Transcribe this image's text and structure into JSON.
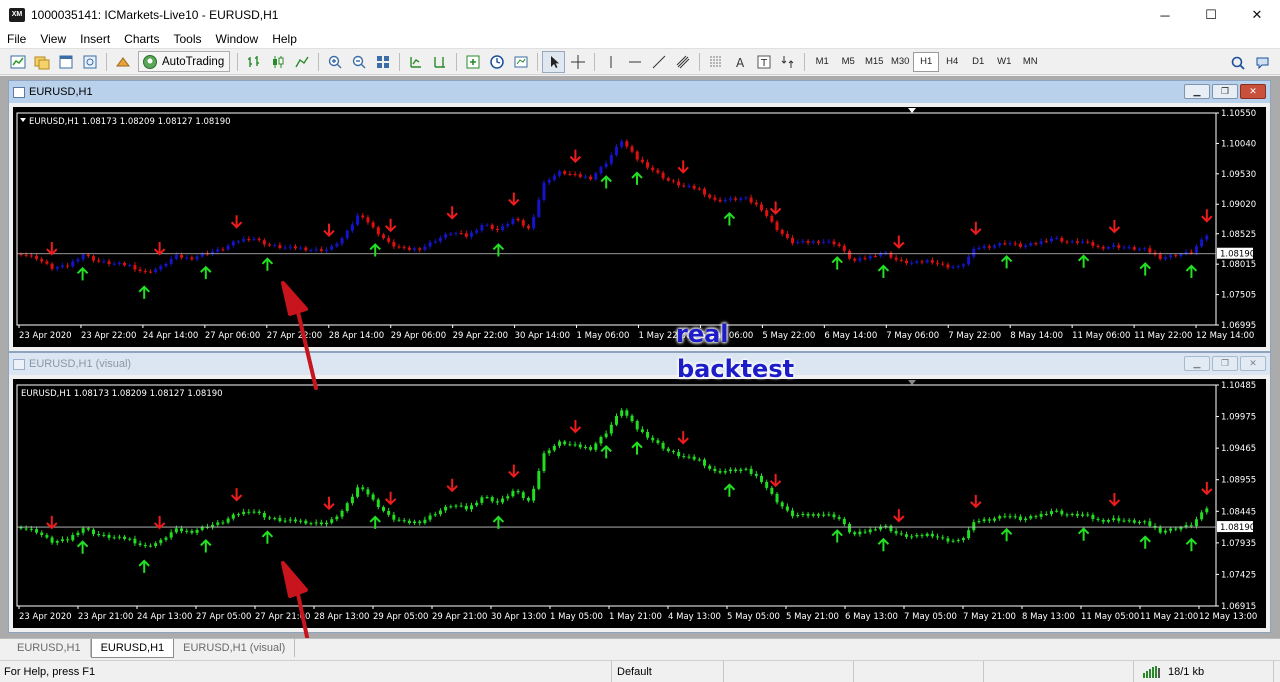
{
  "window": {
    "title": "1000035141: ICMarkets-Live10 - EURUSD,H1",
    "logo_text": "XM",
    "minimize_glyph": "─",
    "maximize_glyph": "☐",
    "close_glyph": "✕"
  },
  "menu": [
    "File",
    "View",
    "Insert",
    "Charts",
    "Tools",
    "Window",
    "Help"
  ],
  "toolbar": {
    "autotrading_label": "AutoTrading",
    "timeframes": [
      "M1",
      "M5",
      "M15",
      "M30",
      "H1",
      "H4",
      "D1",
      "W1",
      "MN"
    ],
    "active_timeframe": "H1",
    "icons": [
      "new-chart-icon",
      "profiles-icon",
      "market-watch-icon",
      "navigator-icon",
      "print-preview-icon",
      "expert-icon",
      "bar-chart-icon",
      "candlestick-icon",
      "line-chart-icon",
      "zoom-in-icon",
      "zoom-out-icon",
      "tile-windows-icon",
      "auto-scroll-icon",
      "chart-shift-icon",
      "indicators-icon",
      "periods-icon",
      "templates-icon",
      "cursor-icon",
      "crosshair-icon",
      "vertical-line-icon",
      "horizontal-line-icon",
      "trendline-icon",
      "channel-icon",
      "fibonacci-icon",
      "text-icon",
      "text-label-icon",
      "arrows-icon",
      "search-icon",
      "community-icon"
    ]
  },
  "charts": [
    {
      "window_title": "EURUSD,H1",
      "header_text": "EURUSD,H1  1.08173 1.08209 1.08127 1.08190",
      "header_triangle": true,
      "price_ticks": [
        "1.10550",
        "1.10040",
        "1.09530",
        "1.09020",
        "1.08525",
        "1.08015",
        "1.07505",
        "1.06995"
      ],
      "current_price": "1.08190",
      "time_ticks": [
        "23 Apr 2020",
        "23 Apr 22:00",
        "24 Apr 14:00",
        "27 Apr 06:00",
        "27 Apr 22:00",
        "28 Apr 14:00",
        "29 Apr 06:00",
        "29 Apr 22:00",
        "30 Apr 14:00",
        "1 May 06:00",
        "1 May 22:00",
        "5 May 06:00",
        "5 May 22:00",
        "6 May 14:00",
        "7 May 06:00",
        "7 May 22:00",
        "8 May 14:00",
        "11 May 06:00",
        "11 May 22:00",
        "12 May 14:00"
      ],
      "colors": {
        "up": "#1414cc",
        "down": "#dd1111"
      }
    },
    {
      "window_title": "EURUSD,H1 (visual)",
      "header_text": "EURUSD,H1  1.08173 1.08209 1.08127 1.08190",
      "header_triangle": false,
      "price_ticks": [
        "1.10485",
        "1.09975",
        "1.09465",
        "1.08955",
        "1.08445",
        "1.07935",
        "1.07425",
        "1.06915"
      ],
      "current_price": "1.08190",
      "time_ticks": [
        "23 Apr 2020",
        "23 Apr 21:00",
        "24 Apr 13:00",
        "27 Apr 05:00",
        "27 Apr 21:00",
        "28 Apr 13:00",
        "29 Apr 05:00",
        "29 Apr 21:00",
        "30 Apr 13:00",
        "1 May 05:00",
        "1 May 21:00",
        "4 May 13:00",
        "5 May 05:00",
        "5 May 21:00",
        "6 May 13:00",
        "7 May 05:00",
        "7 May 21:00",
        "8 May 13:00",
        "11 May 05:00",
        "11 May 21:00",
        "12 May 13:00"
      ],
      "colors": {
        "up": "#22dd22",
        "down": "#22dd22"
      }
    }
  ],
  "overlay": {
    "real": "real",
    "backtest": "backtest"
  },
  "tabs": [
    {
      "label": "EURUSD,H1",
      "active": false
    },
    {
      "label": "EURUSD,H1",
      "active": true
    },
    {
      "label": "EURUSD,H1 (visual)",
      "active": false
    }
  ],
  "status": {
    "help": "For Help, press F1",
    "profile": "Default",
    "traffic": "18/1 kb"
  },
  "chart_data": {
    "type": "candlestick",
    "symbol": "EURUSD",
    "timeframe": "H1",
    "close_path": [
      1.0819,
      1.0812,
      1.0795,
      1.0798,
      1.0818,
      1.0806,
      1.0802,
      1.08,
      1.0787,
      1.0795,
      1.0815,
      1.0811,
      1.082,
      1.0826,
      1.084,
      1.0846,
      1.0834,
      1.0829,
      1.0829,
      1.0825,
      1.0826,
      1.0848,
      1.0888,
      1.0858,
      1.0834,
      1.0826,
      1.0828,
      1.0843,
      1.0855,
      1.0848,
      1.0869,
      1.0858,
      1.0878,
      1.086,
      1.094,
      1.0956,
      1.095,
      1.0946,
      1.0972,
      1.1009,
      1.0978,
      1.096,
      1.0942,
      1.0932,
      1.0928,
      1.0908,
      1.091,
      1.0912,
      1.0897,
      1.0863,
      1.0838,
      1.0838,
      1.084,
      1.0836,
      1.0806,
      1.0813,
      1.0822,
      1.0806,
      1.0803,
      1.0808,
      1.0798,
      1.0796,
      1.0829,
      1.0832,
      1.0838,
      1.0831,
      1.0837,
      1.0846,
      1.0838,
      1.0839,
      1.0829,
      1.0832,
      1.0828,
      1.0826,
      1.0812,
      1.0817,
      1.0822,
      1.085
    ],
    "sell_arrow_bars": [
      2,
      9,
      14,
      20,
      24,
      28,
      32,
      36,
      43,
      49,
      57,
      62,
      71,
      77,
      84,
      89
    ],
    "buy_arrow_bars": [
      4,
      8,
      12,
      16,
      23,
      31,
      38,
      40,
      46,
      53,
      56,
      64,
      69,
      73,
      76,
      83,
      87
    ]
  }
}
